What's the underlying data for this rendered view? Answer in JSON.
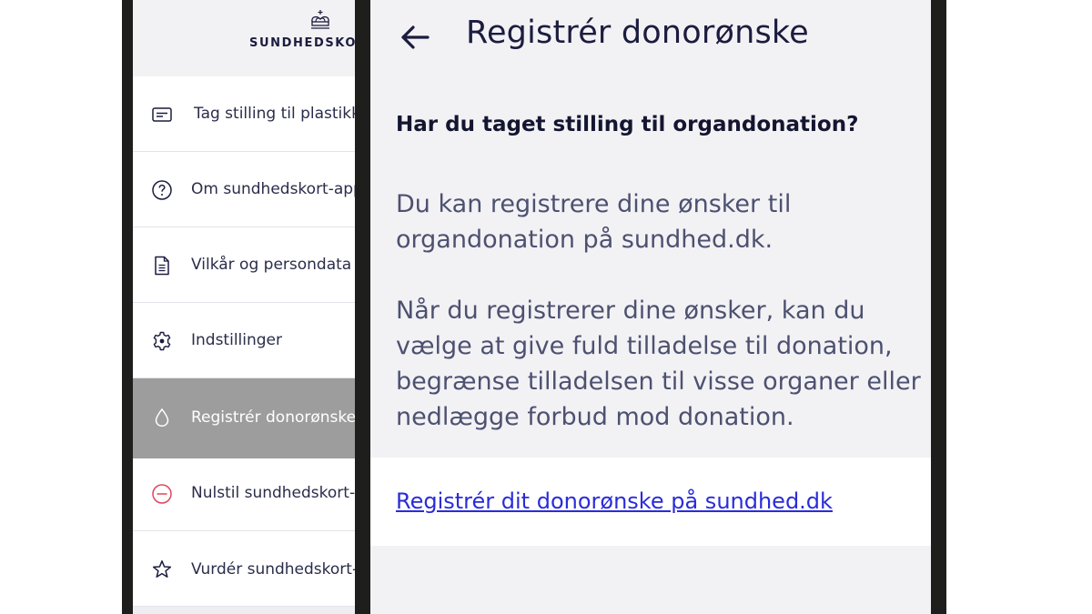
{
  "left_menu": {
    "brand": "SUNDHEDSKO",
    "items": [
      {
        "label": "Tag stilling til plastikk",
        "icon": "card-icon"
      },
      {
        "label": "Om sundhedskort-app",
        "icon": "help-circle-icon"
      },
      {
        "label": "Vilkår og persondata",
        "icon": "document-icon"
      },
      {
        "label": "Indstillinger",
        "icon": "gear-icon"
      },
      {
        "label": "Registrér donorønske",
        "icon": "drop-icon",
        "active": true
      },
      {
        "label": "Nulstil sundhedskort-",
        "icon": "minus-circle-icon"
      },
      {
        "label": "Vurdér sundhedskort-",
        "icon": "star-icon"
      }
    ]
  },
  "detail": {
    "title": "Registrér donorønske",
    "question": "Har du taget stilling til organdonation?",
    "paragraph1": "Du kan registrere dine ønsker til organdonation på sundhed.dk.",
    "paragraph2": "Når du registrerer dine ønsker, kan du vælge at give fuld tilladelse til donation, begrænse tilladelsen til visse organer eller nedlægge forbud mod donation.",
    "link": "Registrér dit donorønske på sundhed.dk"
  },
  "colors": {
    "navy": "#1b1c3e",
    "link": "#2a2cd9",
    "active_row": "#9e9d9d",
    "reset_red": "#e0455b"
  }
}
